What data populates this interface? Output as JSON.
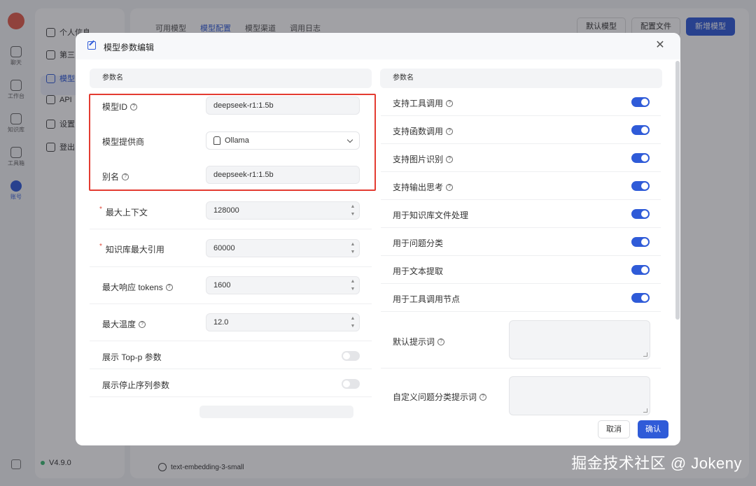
{
  "app": {
    "rail": [
      {
        "label": "聊天"
      },
      {
        "label": "工作台"
      },
      {
        "label": "知识库"
      },
      {
        "label": "工具箱"
      },
      {
        "label": "账号"
      }
    ],
    "subnav": [
      {
        "label": "个人信息"
      },
      {
        "label": "第三"
      },
      {
        "label": "模型"
      },
      {
        "label": "API"
      },
      {
        "label": "设置"
      },
      {
        "label": "登出"
      }
    ],
    "version": "V4.9.0",
    "tabs": [
      "可用模型",
      "模型配置",
      "模型渠道",
      "调用日志"
    ],
    "actions": {
      "default_model": "默认模型",
      "config_file": "配置文件",
      "add_model": "新增模型"
    },
    "bg_model_row": "text-embedding-3-small"
  },
  "modal": {
    "title": "模型参数编辑",
    "left_header": "参数名",
    "right_header": "参数名",
    "model_id": {
      "label": "模型ID",
      "value": "deepseek-r1:1.5b"
    },
    "provider": {
      "label": "模型提供商",
      "value": "Ollama"
    },
    "alias": {
      "label": "别名",
      "value": "deepseek-r1:1.5b"
    },
    "max_context": {
      "label": "最大上下文",
      "value": "128000"
    },
    "kb_max_quote": {
      "label": "知识库最大引用",
      "value": "60000"
    },
    "max_tokens": {
      "label": "最大响应 tokens",
      "value": "1600"
    },
    "max_temp": {
      "label": "最大温度",
      "value": "12.0"
    },
    "show_top_p": {
      "label": "展示 Top-p 参数",
      "on": false
    },
    "show_stop": {
      "label": "展示停止序列参数",
      "on": false
    },
    "switches": [
      {
        "label": "支持工具调用",
        "on": true
      },
      {
        "label": "支持函数调用",
        "on": true
      },
      {
        "label": "支持图片识别",
        "on": true
      },
      {
        "label": "支持输出思考",
        "on": true
      },
      {
        "label": "用于知识库文件处理",
        "on": true
      },
      {
        "label": "用于问题分类",
        "on": true
      },
      {
        "label": "用于文本提取",
        "on": true
      },
      {
        "label": "用于工具调用节点",
        "on": true
      }
    ],
    "default_prompt": {
      "label": "默认提示词",
      "value": ""
    },
    "custom_classify_prompt": {
      "label": "自定义问题分类提示词",
      "value": ""
    },
    "cancel": "取消",
    "confirm": "确认"
  },
  "watermark": "掘金技术社区 @ Jokeny",
  "colors": {
    "accent": "#2f5bd8",
    "highlight": "#e33b31",
    "required": "#e04a3a"
  }
}
